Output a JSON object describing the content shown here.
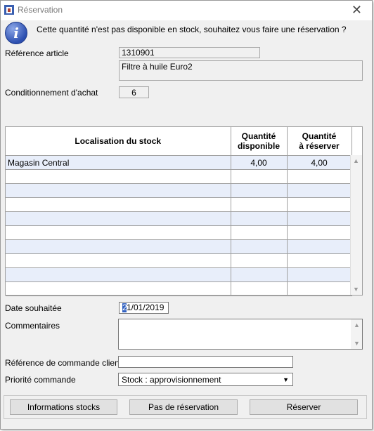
{
  "window": {
    "title": "Réservation"
  },
  "message": "Cette quantité n'est pas disponible en stock, souhaitez vous faire une réservation ?",
  "reference": {
    "label": "Référence article",
    "code": "1310901",
    "description": "Filtre à huile Euro2"
  },
  "conditionnement": {
    "label": "Conditionnement d'achat",
    "value": "6"
  },
  "grid": {
    "headers": {
      "location": "Localisation du stock",
      "available": "Quantité\ndisponible",
      "to_reserve": "Quantité\nà réserver"
    },
    "rows": [
      {
        "location": "Magasin Central",
        "available": "4,00",
        "to_reserve": "4,00"
      },
      {
        "location": "",
        "available": "",
        "to_reserve": ""
      },
      {
        "location": "",
        "available": "",
        "to_reserve": ""
      },
      {
        "location": "",
        "available": "",
        "to_reserve": ""
      },
      {
        "location": "",
        "available": "",
        "to_reserve": ""
      },
      {
        "location": "",
        "available": "",
        "to_reserve": ""
      },
      {
        "location": "",
        "available": "",
        "to_reserve": ""
      },
      {
        "location": "",
        "available": "",
        "to_reserve": ""
      },
      {
        "location": "",
        "available": "",
        "to_reserve": ""
      },
      {
        "location": "",
        "available": "",
        "to_reserve": ""
      }
    ]
  },
  "date": {
    "label": "Date souhaitée",
    "value_first": "2",
    "value_rest": "1/01/2019"
  },
  "comments": {
    "label": "Commentaires",
    "value": ""
  },
  "client_ref": {
    "label": "Référence de commande client",
    "value": ""
  },
  "priority": {
    "label": "Priorité commande",
    "value": "Stock : approvisionnement"
  },
  "buttons": {
    "info": "Informations stocks",
    "none": "Pas de réservation",
    "reserve": "Réserver"
  },
  "colors": {
    "row_alt": "#e8eefa",
    "window_bg": "#f0f0f0"
  }
}
